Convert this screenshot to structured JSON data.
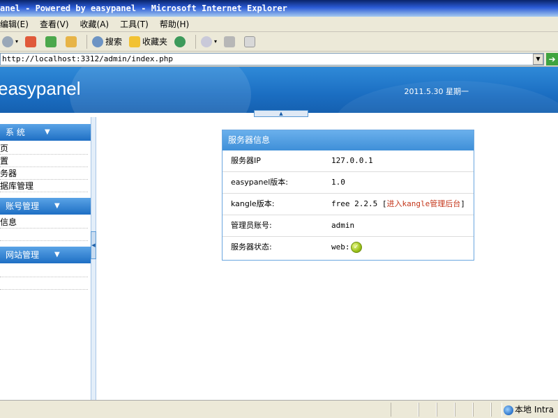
{
  "window": {
    "title": "anel - Powered by easypanel - Microsoft Internet Explorer"
  },
  "menu": {
    "items": [
      "编辑(E)",
      "查看(V)",
      "收藏(A)",
      "工具(T)",
      "帮助(H)"
    ]
  },
  "toolbar": {
    "search_label": "搜索",
    "favorites_label": "收藏夹"
  },
  "address": {
    "url": "http://localhost:3312/admin/index.php"
  },
  "header": {
    "logo": "easypanel",
    "date": "2011.5.30  星期一"
  },
  "sidebar": {
    "sections": [
      {
        "label": "系  统",
        "items": [
          "页",
          "置",
          "务器",
          "据库管理"
        ]
      },
      {
        "label": "账号管理",
        "items": [
          "信息"
        ]
      },
      {
        "label": "网站管理",
        "items": []
      }
    ]
  },
  "server_info": {
    "title": "服务器信息",
    "rows": [
      {
        "key": "服务器IP",
        "value": "127.0.0.1"
      },
      {
        "key": "easypanel版本:",
        "value": "1.0"
      },
      {
        "key": "kangle版本:",
        "value": "free 2.2.5",
        "link_text": "进入kangle管理后台"
      },
      {
        "key": "管理员账号:",
        "value": "admin"
      },
      {
        "key": "服务器状态:",
        "value": "web:"
      }
    ]
  },
  "statusbar": {
    "zone": "本地 Intra"
  },
  "colors": {
    "banner": "#1b6ec2",
    "link_red": "#c4361a",
    "status_ok": "#9cc21a"
  }
}
